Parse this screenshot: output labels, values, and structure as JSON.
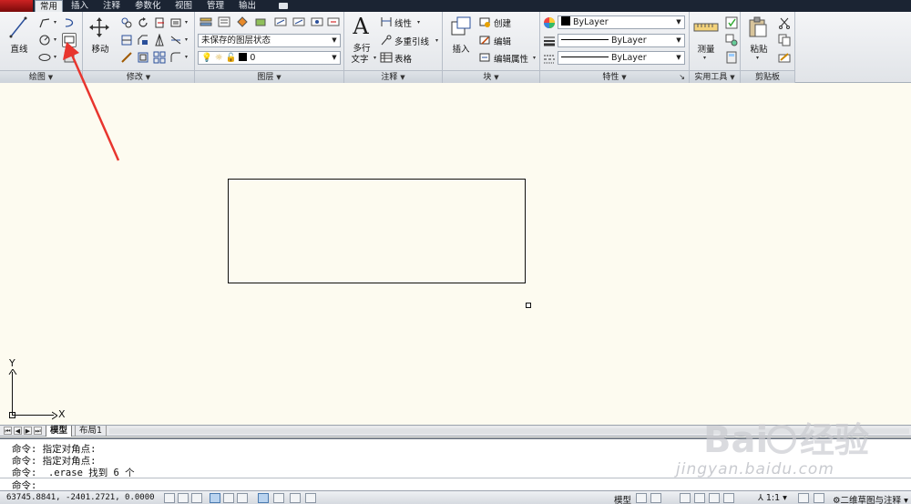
{
  "tabs": [
    "常用",
    "插入",
    "注释",
    "参数化",
    "视图",
    "管理",
    "输出"
  ],
  "panels": {
    "draw": {
      "title": "绘图",
      "line_label": "直线"
    },
    "modify": {
      "title": "修改",
      "move_label": "移动"
    },
    "layers": {
      "title": "图层",
      "layer_state": "未保存的图层状态",
      "current_layer": "0"
    },
    "annotation": {
      "title": "注释",
      "mtext_label": "多行文字",
      "mtext_line1": "多行",
      "mtext_line2": "文字",
      "dim_label": "线性",
      "mleader_label": "多重引线",
      "table_label": "表格"
    },
    "block": {
      "title": "块",
      "insert_label": "插入",
      "create_label": "创建",
      "edit_label": "编辑",
      "edit_attr_label": "编辑属性"
    },
    "properties": {
      "title": "特性",
      "color": "ByLayer",
      "linetype": "ByLayer",
      "lineweight": "ByLayer"
    },
    "utilities": {
      "title": "实用工具",
      "measure_label": "测量"
    },
    "clipboard": {
      "title": "剪贴板",
      "paste_label": "粘贴"
    }
  },
  "ucs": {
    "x_label": "X",
    "y_label": "Y"
  },
  "layout_tabs": [
    "模型",
    "布局1"
  ],
  "command_history": [
    "命令: 指定对角点:",
    "命令: 指定对角点:",
    "命令: _.erase 找到 6 个"
  ],
  "command_prompt": "命令:",
  "status": {
    "coords": "63745.8841, -2401.2721, 0.0000",
    "model_label": "模型",
    "scale_label": "1:1",
    "workspace_label": "二维草图与注释"
  },
  "watermark": {
    "brand": "Bai",
    "brand2": "经验",
    "url": "jingyan.baidu.com"
  },
  "colors": {
    "accent_arrow": "#e8352e",
    "ribbon_bg": "#e9ecef",
    "canvas_bg": "#fdfbf0",
    "tabbar_bg": "#1b2433"
  }
}
